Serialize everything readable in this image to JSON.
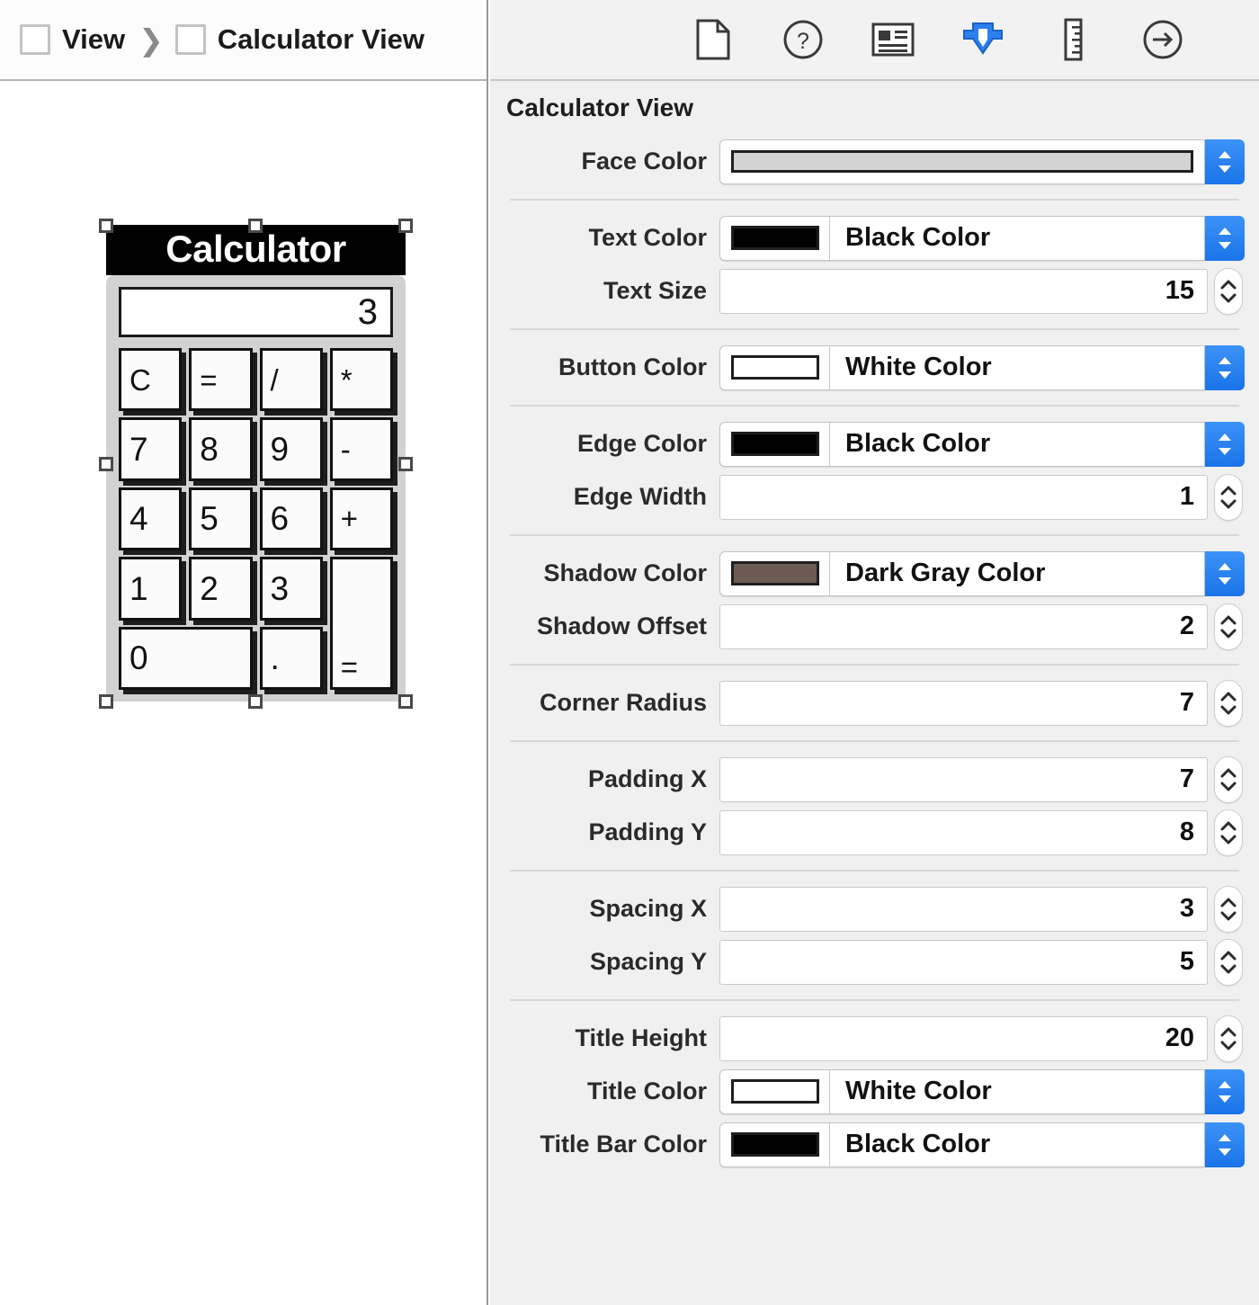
{
  "breadcrumb": {
    "items": [
      {
        "label": "View",
        "icon": "view-square-icon"
      },
      {
        "label": "Calculator View",
        "icon": "view-square-icon"
      }
    ],
    "separator": "❯"
  },
  "toolbar": {
    "buttons": [
      {
        "name": "file-inspector",
        "icon": "document-icon",
        "selected": false
      },
      {
        "name": "quick-help-inspector",
        "icon": "question-circle-icon",
        "selected": false
      },
      {
        "name": "identity-inspector",
        "icon": "identity-card-icon",
        "selected": false
      },
      {
        "name": "attributes-inspector",
        "icon": "attributes-shield-icon",
        "selected": true
      },
      {
        "name": "size-inspector",
        "icon": "ruler-icon",
        "selected": false
      },
      {
        "name": "connections-inspector",
        "icon": "arrow-circle-right-icon",
        "selected": false
      }
    ],
    "accent_color": "#1a74e8"
  },
  "inspector": {
    "title": "Calculator View",
    "groups": [
      {
        "rows": [
          {
            "label": "Face Color",
            "type": "color-popup",
            "value": "",
            "swatch": "#d3d3d3",
            "swatch_full": true
          }
        ]
      },
      {
        "rows": [
          {
            "label": "Text Color",
            "type": "color-popup",
            "value": "Black Color",
            "swatch": "#000000"
          },
          {
            "label": "Text Size",
            "type": "number",
            "value": "15"
          }
        ]
      },
      {
        "rows": [
          {
            "label": "Button Color",
            "type": "color-popup",
            "value": "White Color",
            "swatch": "#ffffff"
          }
        ]
      },
      {
        "rows": [
          {
            "label": "Edge Color",
            "type": "color-popup",
            "value": "Black Color",
            "swatch": "#000000"
          },
          {
            "label": "Edge Width",
            "type": "number",
            "value": "1"
          }
        ]
      },
      {
        "rows": [
          {
            "label": "Shadow Color",
            "type": "color-popup",
            "value": "Dark Gray Color",
            "swatch": "#6b5b52"
          },
          {
            "label": "Shadow Offset",
            "type": "number",
            "value": "2"
          }
        ]
      },
      {
        "rows": [
          {
            "label": "Corner Radius",
            "type": "number",
            "value": "7"
          }
        ]
      },
      {
        "rows": [
          {
            "label": "Padding X",
            "type": "number",
            "value": "7"
          },
          {
            "label": "Padding Y",
            "type": "number",
            "value": "8"
          }
        ]
      },
      {
        "rows": [
          {
            "label": "Spacing X",
            "type": "number",
            "value": "3"
          },
          {
            "label": "Spacing Y",
            "type": "number",
            "value": "5"
          }
        ]
      },
      {
        "rows": [
          {
            "label": "Title Height",
            "type": "number",
            "value": "20"
          },
          {
            "label": "Title Color",
            "type": "color-popup",
            "value": "White Color",
            "swatch": "#ffffff"
          },
          {
            "label": "Title Bar Color",
            "type": "color-popup",
            "value": "Black Color",
            "swatch": "#000000"
          }
        ]
      }
    ]
  },
  "canvas": {
    "calculator": {
      "title": "Calculator",
      "display_value": "3",
      "title_bar_color": "#000000",
      "title_color": "#ffffff",
      "face_color": "#d2d2d2",
      "button_color": "#ffffff",
      "edge_color": "#000000",
      "keys": [
        {
          "label": "C",
          "span_cols": 1,
          "span_rows": 1
        },
        {
          "label": "=",
          "span_cols": 1,
          "span_rows": 1
        },
        {
          "label": "/",
          "span_cols": 1,
          "span_rows": 1
        },
        {
          "label": "*",
          "span_cols": 1,
          "span_rows": 1
        },
        {
          "label": "7",
          "span_cols": 1,
          "span_rows": 1
        },
        {
          "label": "8",
          "span_cols": 1,
          "span_rows": 1
        },
        {
          "label": "9",
          "span_cols": 1,
          "span_rows": 1
        },
        {
          "label": "-",
          "span_cols": 1,
          "span_rows": 1
        },
        {
          "label": "4",
          "span_cols": 1,
          "span_rows": 1
        },
        {
          "label": "5",
          "span_cols": 1,
          "span_rows": 1
        },
        {
          "label": "6",
          "span_cols": 1,
          "span_rows": 1
        },
        {
          "label": "+",
          "span_cols": 1,
          "span_rows": 1
        },
        {
          "label": "1",
          "span_cols": 1,
          "span_rows": 1
        },
        {
          "label": "2",
          "span_cols": 1,
          "span_rows": 1
        },
        {
          "label": "3",
          "span_cols": 1,
          "span_rows": 1
        },
        {
          "label": "=",
          "span_cols": 1,
          "span_rows": 2
        },
        {
          "label": "0",
          "span_cols": 2,
          "span_rows": 1
        },
        {
          "label": ".",
          "span_cols": 1,
          "span_rows": 1
        }
      ],
      "selected": true
    }
  }
}
